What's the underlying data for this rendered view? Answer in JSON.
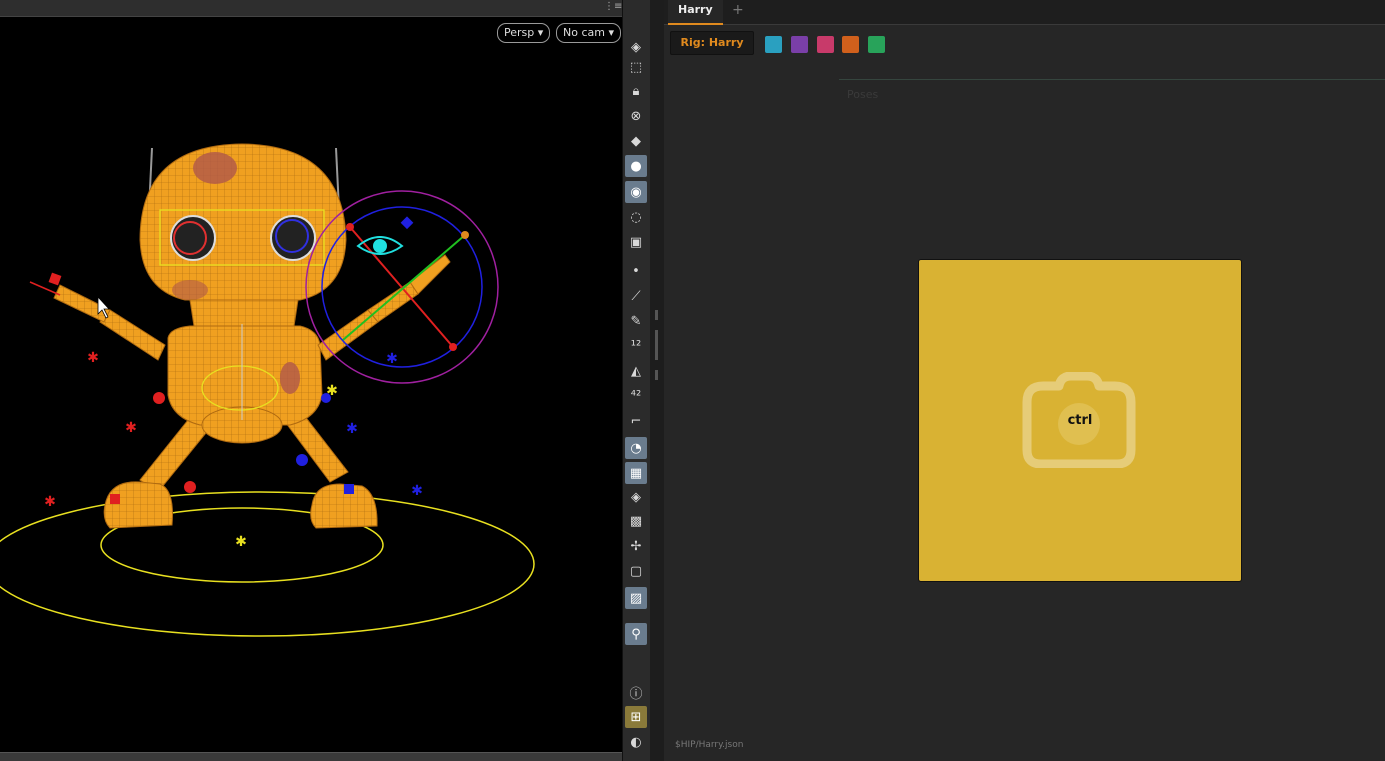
{
  "viewport": {
    "persp_label": "Persp",
    "camera_label": "No cam"
  },
  "toolbar": {
    "icons": [
      "handles-icon",
      "view-icon",
      "lock-icon",
      "ghost-icon",
      "lighting-icon",
      "headlight-icon",
      "camera-icon",
      "visibility-icon",
      "display-icon",
      "point-icon",
      "wire-icon",
      "brush-icon",
      "point-number-icon",
      "shade-icon",
      "prim-number-icon",
      "curve-icon",
      "smooth-icon",
      "checker-icon",
      "layer-icon",
      "box-icon",
      "axis-icon",
      "frame-icon",
      "background-icon",
      "pin-icon",
      "info-icon",
      "grid-layout-icon",
      "eye-icon"
    ]
  },
  "pane": {
    "tab_label": "Harry",
    "tab_add": "+",
    "rig_button": "Rig: Harry",
    "swatches": [
      "#2aa0c0",
      "#7a3fa8",
      "#c83a6a",
      "#d0601c",
      "#28a35a"
    ],
    "poses_label": "Poses",
    "pose_card": {
      "label": "ctrl",
      "color": "#d9b233",
      "icon": "camera-icon"
    },
    "file_path": "$HIP/Harry.json"
  },
  "colors": {
    "accent": "#e08a1e",
    "viewport_bg": "#000000",
    "robot": "#f0a020"
  }
}
